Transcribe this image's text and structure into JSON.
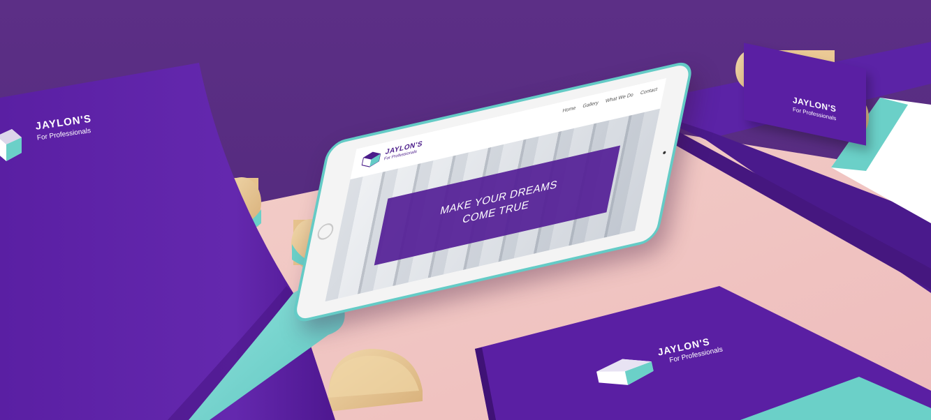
{
  "brand": {
    "name": "JAYLON'S",
    "tagline": "For Professionals",
    "colors": {
      "purple": "#5a1fa3",
      "purple_dark": "#4b1d8a",
      "teal": "#64cbc6",
      "pink": "#f2c6c6",
      "wall": "#5a2e83"
    }
  },
  "tablet_site": {
    "nav": [
      "Home",
      "Gallery",
      "What We Do",
      "Contact"
    ],
    "hero_lines": [
      "MAKE YOUR DREAMS",
      "COME TRUE"
    ]
  },
  "icons": {
    "logo": "hexagon-cube-icon",
    "home_button": "circle-button-icon"
  }
}
